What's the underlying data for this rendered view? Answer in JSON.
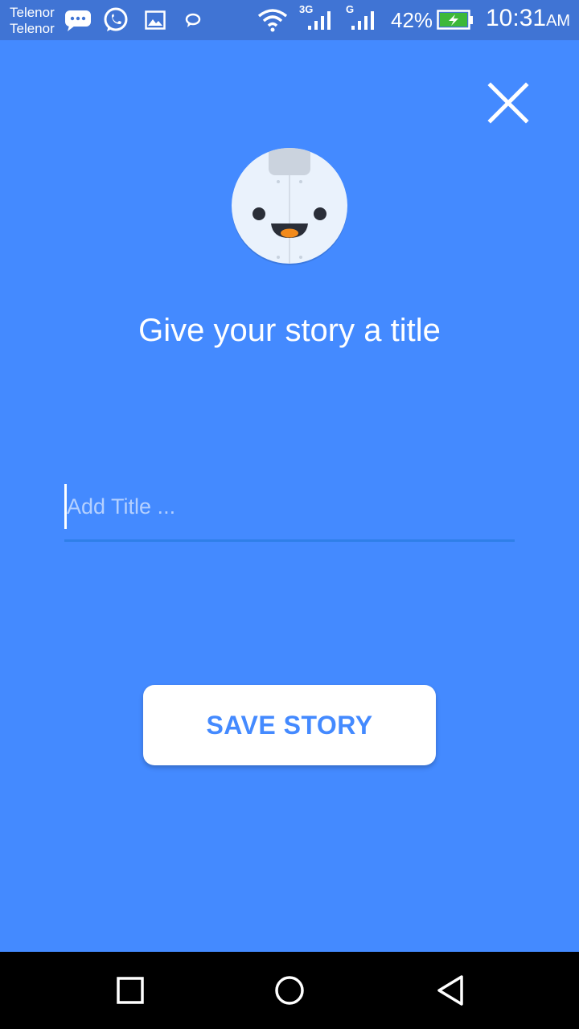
{
  "status_bar": {
    "carrier_1": "Telenor",
    "carrier_2": "Telenor",
    "network_1": "3G",
    "network_2": "G",
    "battery": "42%",
    "time": "10:31",
    "ampm": "AM",
    "icons": [
      "messages-icon",
      "whatsapp-icon",
      "gallery-icon",
      "chat-icon",
      "wifi-icon",
      "signal-icon",
      "signal-icon",
      "battery-charging-icon"
    ]
  },
  "screen": {
    "title": "Give your story a title",
    "input": {
      "value": "",
      "placeholder": "Add Title ..."
    },
    "save_label": "SAVE STORY"
  },
  "colors": {
    "background": "#448AFF",
    "status_bar": "#4074D4",
    "button_text": "#448AFF"
  },
  "nav": {
    "icons": [
      "recents-icon",
      "home-icon",
      "back-icon"
    ]
  }
}
